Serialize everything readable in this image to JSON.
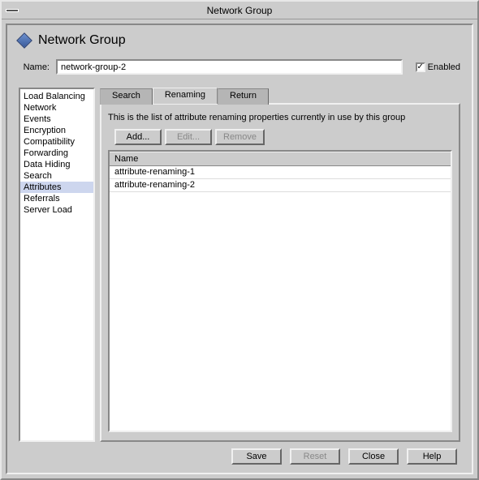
{
  "window": {
    "title": "Network Group"
  },
  "header": {
    "title": "Network Group"
  },
  "form": {
    "name_label": "Name:",
    "name_value": "network-group-2",
    "enabled_label": "Enabled",
    "enabled_checked": true
  },
  "sidebar": {
    "items": [
      "Load Balancing",
      "Network",
      "Events",
      "Encryption",
      "Compatibility",
      "Forwarding",
      "Data Hiding",
      "Search",
      "Attributes",
      "Referrals",
      "Server Load"
    ],
    "selected_index": 8
  },
  "tabs": {
    "items": [
      "Search",
      "Renaming",
      "Return"
    ],
    "active_index": 1
  },
  "panel": {
    "description": "This is the list of attribute renaming properties currently in use by this group",
    "buttons": {
      "add": "Add...",
      "edit": "Edit...",
      "remove": "Remove"
    },
    "table": {
      "header": "Name",
      "rows": [
        "attribute-renaming-1",
        "attribute-renaming-2"
      ]
    }
  },
  "footer": {
    "save": "Save",
    "reset": "Reset",
    "close": "Close",
    "help": "Help"
  }
}
